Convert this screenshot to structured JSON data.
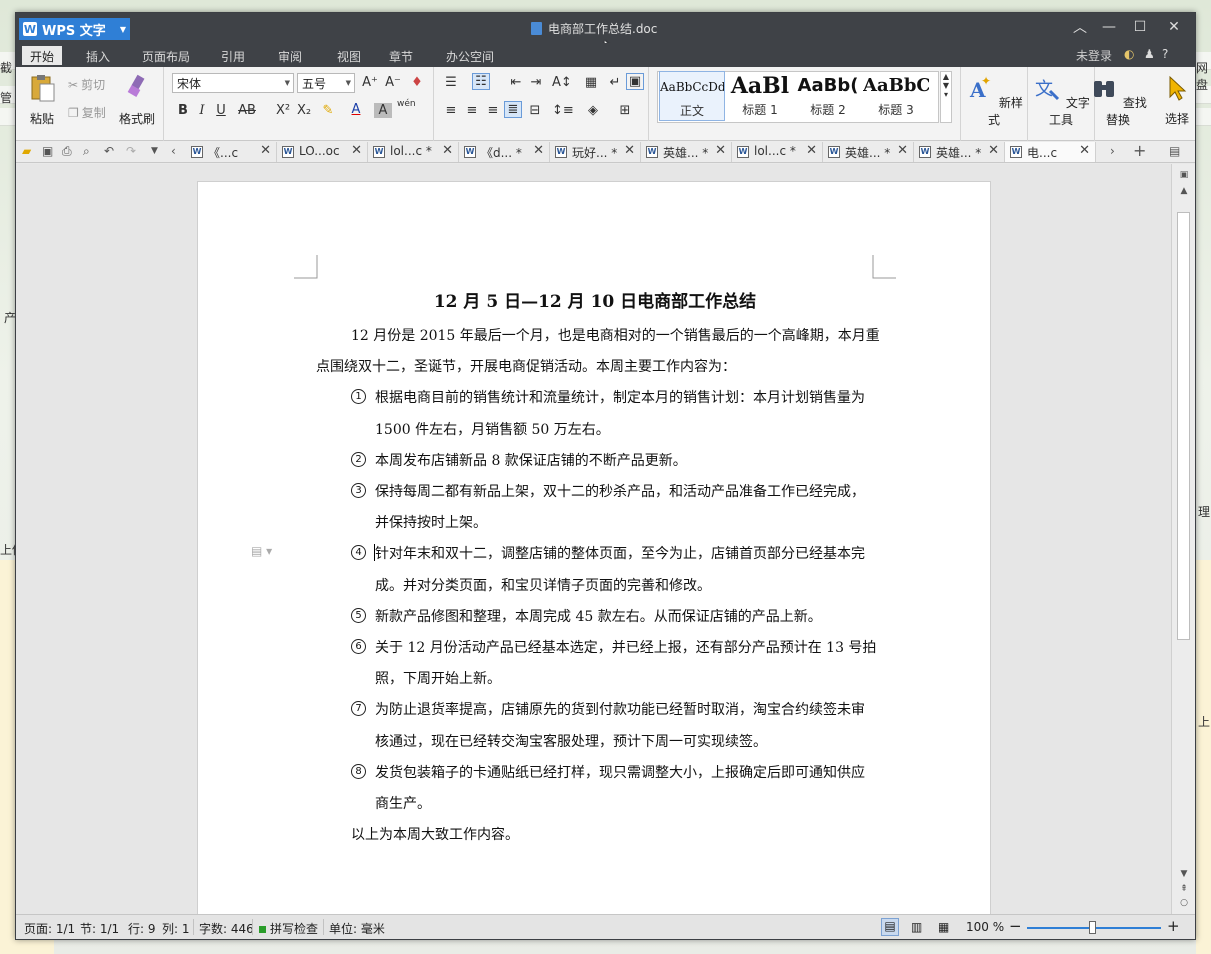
{
  "window": {
    "app_name": "WPS 文字",
    "app_logo": "W",
    "doc_title": "电商部工作总结.doc",
    "login": "未登录"
  },
  "menu": [
    "开始",
    "插入",
    "页面布局",
    "引用",
    "审阅",
    "视图",
    "章节",
    "办公空间"
  ],
  "ribbon": {
    "paste": "粘贴",
    "cut": "剪切",
    "copy": "复制",
    "format_painter": "格式刷",
    "font_name": "宋体",
    "font_size": "五号",
    "bold": "B",
    "italic": "I",
    "underline": "U",
    "strike": "AB",
    "superscript": "X²",
    "subscript": "X₂",
    "font_color": "A",
    "char_shading": "A",
    "phonetic": "wén",
    "styles": [
      {
        "sample": "AaBbCcDd",
        "label": "正文"
      },
      {
        "sample": "AaBl",
        "label": "标题 1"
      },
      {
        "sample": "AaBb(",
        "label": "标题 2"
      },
      {
        "sample": "AaBbC",
        "label": "标题 3"
      }
    ],
    "new_style": "新样式",
    "text_tools": "文字工具",
    "find_replace": "查找替换",
    "select": "选择"
  },
  "doc_tabs": [
    "《...c",
    "LO...oc",
    "lol...c *",
    "《d... *",
    "玩好... *",
    "英雄... *",
    "lol...c *",
    "英雄... *",
    "英雄... *",
    "电...c"
  ],
  "document": {
    "heading": "12 月 5 日—12 月 10 日电商部工作总结",
    "intro_line1": "12 月份是 2015 年最后一个月，也是电商相对的一个销售最后的一个高峰期，本月重",
    "intro_line2": "点围绕双十二，圣诞节，开展电商促销活动。本周主要工作内容为：",
    "items": [
      {
        "num": "1",
        "lines": [
          "根据电商目前的销售统计和流量统计，制定本月的销售计划：本月计划销售量为",
          "1500 件左右，月销售额 50 万左右。"
        ]
      },
      {
        "num": "2",
        "lines": [
          "本周发布店铺新品 8 款保证店铺的不断产品更新。"
        ]
      },
      {
        "num": "3",
        "lines": [
          "保持每周二都有新品上架，双十二的秒杀产品，和活动产品准备工作已经完成，",
          "并保持按时上架。"
        ]
      },
      {
        "num": "4",
        "lines": [
          "针对年末和双十二，调整店铺的整体页面，至今为止，店铺首页部分已经基本完",
          "成。并对分类页面，和宝贝详情子页面的完善和修改。"
        ]
      },
      {
        "num": "5",
        "lines": [
          "新款产品修图和整理，本周完成 45 款左右。从而保证店铺的产品上新。"
        ]
      },
      {
        "num": "6",
        "lines": [
          "关于 12 月份活动产品已经基本选定，并已经上报，还有部分产品预计在 13 号拍",
          "照，下周开始上新。"
        ]
      },
      {
        "num": "7",
        "lines": [
          "为防止退货率提高，店铺原先的货到付款功能已经暂时取消，淘宝合约续签未审",
          "核通过，现在已经转交淘宝客服处理，预计下周一可实现续签。"
        ]
      },
      {
        "num": "8",
        "lines": [
          "发货包装箱子的卡通贴纸已经打样，现只需调整大小，上报确定后即可通知供应",
          "商生产。"
        ]
      }
    ],
    "closing": "以上为本周大致工作内容。"
  },
  "status": {
    "page": "页面: 1/1",
    "section": "节: 1/1",
    "row": "行: 9",
    "col": "列: 1",
    "words": "字数: 446",
    "spell": "拼写检查",
    "unit": "单位: 毫米",
    "zoom": "100 %",
    "zoom_level_percent": 100
  },
  "background": {
    "edge_texts": [
      "截",
      "管",
      "产",
      "理",
      "上传",
      "网盘",
      "上"
    ]
  },
  "colors": {
    "title_bar": "#3f4247",
    "accent": "#2f7fd6"
  }
}
